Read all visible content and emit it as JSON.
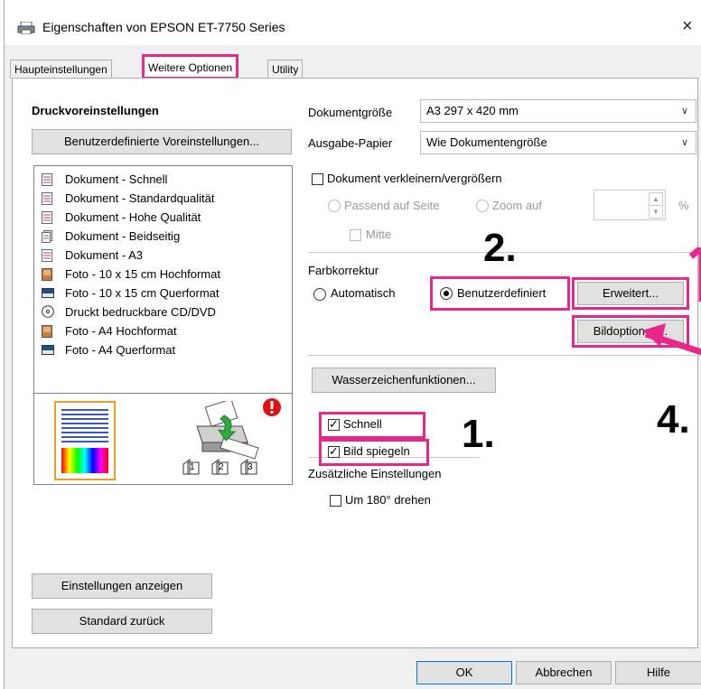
{
  "window": {
    "title": "Eigenschaften von EPSON ET-7750 Series",
    "close_glyph": "×"
  },
  "tabs": [
    {
      "label": "Haupteinstellungen",
      "active": false
    },
    {
      "label": "Weitere Optionen",
      "active": true
    },
    {
      "label": "Utility",
      "active": false
    }
  ],
  "presets": {
    "heading": "Druckvoreinstellungen",
    "custom_button": "Benutzerdefinierte Voreinstellungen...",
    "items": [
      {
        "label": "Dokument - Schnell",
        "icon": "document-icon"
      },
      {
        "label": "Dokument - Standardqualität",
        "icon": "document-icon"
      },
      {
        "label": "Dokument - Hohe Qualität",
        "icon": "document-icon"
      },
      {
        "label": "Dokument - Beidseitig",
        "icon": "duplex-document-icon"
      },
      {
        "label": "Dokument - A3",
        "icon": "document-icon"
      },
      {
        "label": "Foto - 10 x 15 cm Hochformat",
        "icon": "photo-portrait-icon"
      },
      {
        "label": "Foto - 10 x 15 cm Querformat",
        "icon": "photo-landscape-icon"
      },
      {
        "label": "Druckt bedruckbare CD/DVD",
        "icon": "cd-icon"
      },
      {
        "label": "Foto - A4 Hochformat",
        "icon": "photo-portrait-icon"
      },
      {
        "label": "Foto - A4 Querformat",
        "icon": "photo-landscape-icon"
      }
    ],
    "show_settings_button": "Einstellungen anzeigen",
    "reset_button": "Standard zurück"
  },
  "preview": {
    "copies": [
      "1",
      "2",
      "3"
    ]
  },
  "document_size": {
    "label": "Dokumentgröße",
    "value": "A3 297 x 420 mm"
  },
  "output_paper": {
    "label": "Ausgabe-Papier",
    "value": "Wie Dokumentengröße"
  },
  "scaling": {
    "checkbox_label": "Dokument verkleinern/vergrößern",
    "fit_page_label": "Passend auf Seite",
    "zoom_label": "Zoom auf",
    "percent_symbol": "%",
    "center_label": "Mitte"
  },
  "color_correction": {
    "label": "Farbkorrektur",
    "automatic_label": "Automatisch",
    "custom_label": "Benutzerdefiniert",
    "advanced_button": "Erweitert...",
    "image_options_button": "Bildoptionen..."
  },
  "watermark_button": "Wasserzeichenfunktionen...",
  "extra": {
    "heading": "Zusätzliche Einstellungen",
    "rotate_label": "Um 180° drehen",
    "fast_label": "Schnell",
    "mirror_label": "Bild spiegeln"
  },
  "annotations": [
    "1.",
    "2.",
    "4."
  ],
  "dialog_buttons": {
    "ok": "OK",
    "cancel": "Abbrechen",
    "help": "Hilfe"
  },
  "colors": {
    "highlight": "#e8278b"
  }
}
